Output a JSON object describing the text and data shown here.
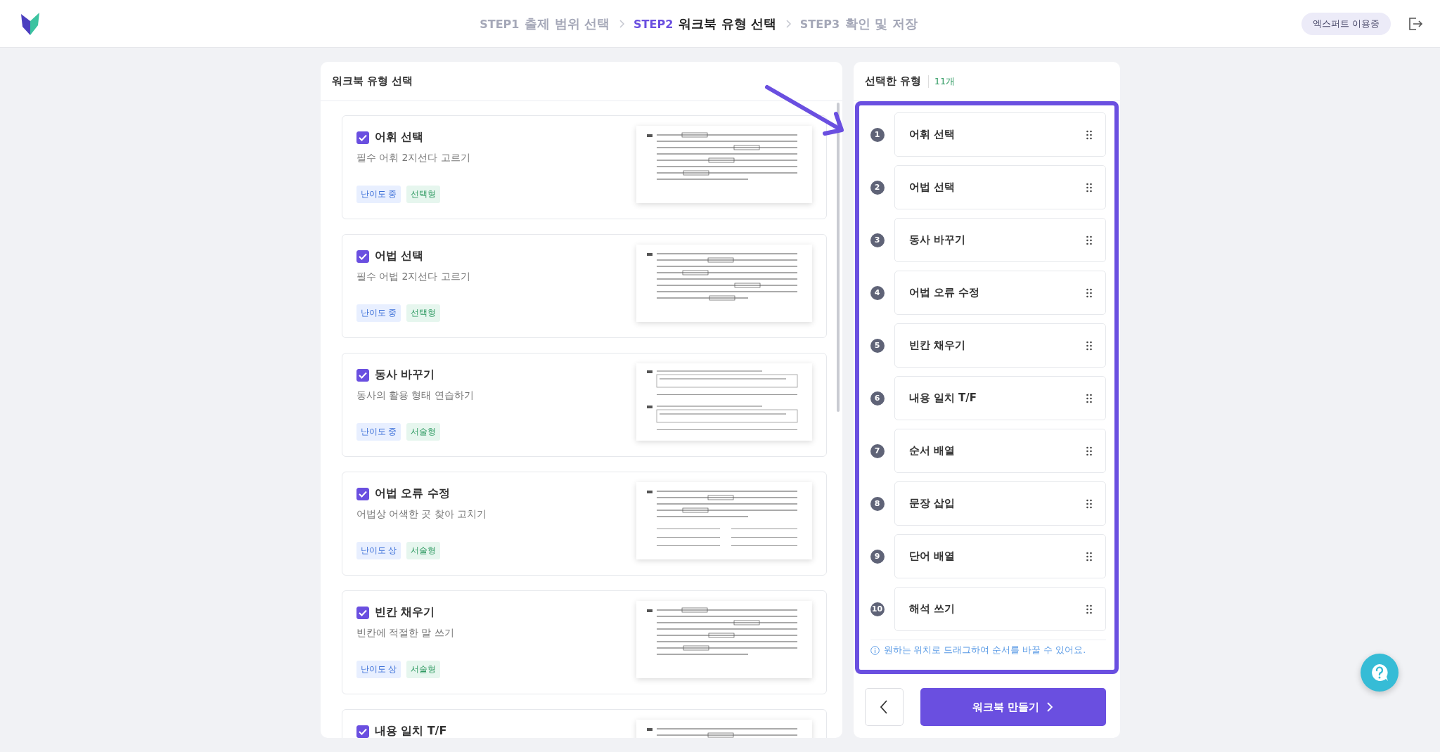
{
  "header": {
    "steps": [
      {
        "step": "STEP1",
        "title": "출제 범위 선택",
        "selected": false
      },
      {
        "step": "STEP2",
        "title": "워크북 유형 선택",
        "selected": true
      },
      {
        "step": "STEP3",
        "title": "확인 및 저장",
        "selected": false
      }
    ],
    "badge": "엑스퍼트 이용중"
  },
  "type_panel": {
    "title": "워크북 유형 선택",
    "cards": [
      {
        "title": "어휘 선택",
        "checked": true,
        "subtitle": "필수 어휘 2지선다 고르기",
        "difficulty": "난이도 중",
        "format": "선택형"
      },
      {
        "title": "어법 선택",
        "checked": true,
        "subtitle": "필수 어법 2지선다 고르기",
        "difficulty": "난이도 중",
        "format": "선택형"
      },
      {
        "title": "동사 바꾸기",
        "checked": true,
        "subtitle": "동사의 활용 형태 연습하기",
        "difficulty": "난이도 중",
        "format": "서술형"
      },
      {
        "title": "어법 오류 수정",
        "checked": true,
        "subtitle": "어법상 어색한 곳 찾아 고치기",
        "difficulty": "난이도 상",
        "format": "서술형"
      },
      {
        "title": "빈칸 채우기",
        "checked": true,
        "subtitle": "빈칸에 적절한 말 쓰기",
        "difficulty": "난이도 상",
        "format": "서술형"
      },
      {
        "title": "내용 일치 T/F",
        "checked": true
      }
    ]
  },
  "selected_panel": {
    "title": "선택한 유형",
    "count": "11개",
    "items": [
      {
        "number": "1",
        "label": "어휘 선택"
      },
      {
        "number": "2",
        "label": "어법 선택"
      },
      {
        "number": "3",
        "label": "동사 바꾸기"
      },
      {
        "number": "4",
        "label": "어법 오류 수정"
      },
      {
        "number": "5",
        "label": "빈칸 채우기"
      },
      {
        "number": "6",
        "label": "내용 일치 T/F"
      },
      {
        "number": "7",
        "label": "순서 배열"
      },
      {
        "number": "8",
        "label": "문장 삽입"
      },
      {
        "number": "9",
        "label": "단어 배열"
      },
      {
        "number": "10",
        "label": "해석 쓰기"
      }
    ],
    "hint": "원하는 위치로 드래그하여 순서를 바꿀 수 있어요.",
    "create_button": "워크북 만들기"
  }
}
